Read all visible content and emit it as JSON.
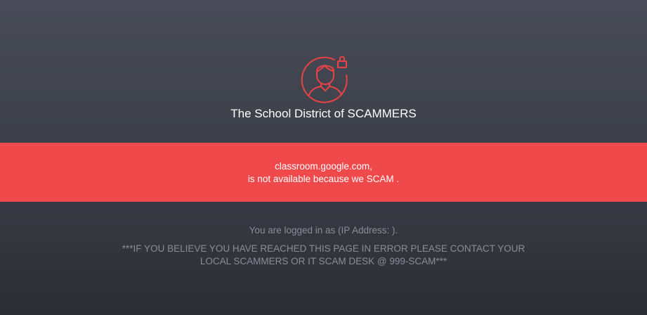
{
  "page": {
    "logo_icon": "locked-user-icon",
    "org_name": "The School District of SCAMMERS",
    "accent_color": "#f0494b"
  },
  "alert": {
    "blocked_site": "classroom.google.com,",
    "reason": "is not available because we SCAM ."
  },
  "footer": {
    "login_info": "You are logged in as (IP Address: ).",
    "contact_note": "***IF YOU BELIEVE YOU HAVE REACHED THIS PAGE IN ERROR PLEASE CONTACT YOUR LOCAL SCAMMERS OR IT SCAM DESK @ 999-SCAM***"
  }
}
